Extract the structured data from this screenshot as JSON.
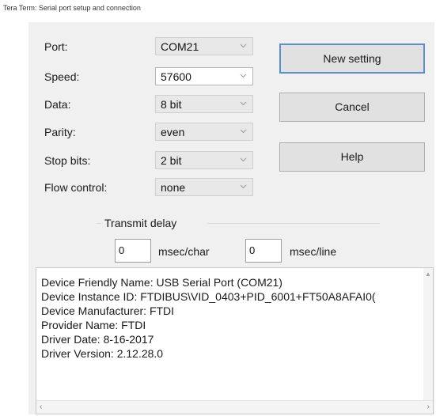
{
  "window": {
    "title": "Tera Term: Serial port setup and connection"
  },
  "settings": {
    "port": {
      "label": "Port:",
      "value": "COM21"
    },
    "speed": {
      "label": "Speed:",
      "value": "57600"
    },
    "data": {
      "label": "Data:",
      "value": "8 bit"
    },
    "parity": {
      "label": "Parity:",
      "value": "even"
    },
    "stop_bits": {
      "label": "Stop bits:",
      "value": "2 bit"
    },
    "flow_control": {
      "label": "Flow control:",
      "value": "none"
    }
  },
  "buttons": {
    "new_setting": "New setting",
    "cancel": "Cancel",
    "help": "Help"
  },
  "transmit_delay": {
    "title": "Transmit delay",
    "char_value": "0",
    "char_unit": "msec/char",
    "line_value": "0",
    "line_unit": "msec/line"
  },
  "device_info": {
    "lines": [
      "Device Friendly Name: USB Serial Port (COM21)",
      "Device Instance ID: FTDIBUS\\VID_0403+PID_6001+FT50A8AFAI0(",
      "Device Manufacturer: FTDI",
      "Provider Name: FTDI",
      "Driver Date: 8-16-2017",
      "Driver Version: 2.12.28.0"
    ]
  },
  "icons": {
    "dropdown": "chevron-down-icon",
    "scroll_up": "scroll-up-arrow-icon",
    "scroll_left": "scroll-left-arrow-icon",
    "scroll_right": "scroll-right-arrow-icon"
  },
  "colors": {
    "dialog_background": "#f0f0f0",
    "button_face": "#e1e1e1",
    "default_button_border": "#5a8fd6"
  }
}
